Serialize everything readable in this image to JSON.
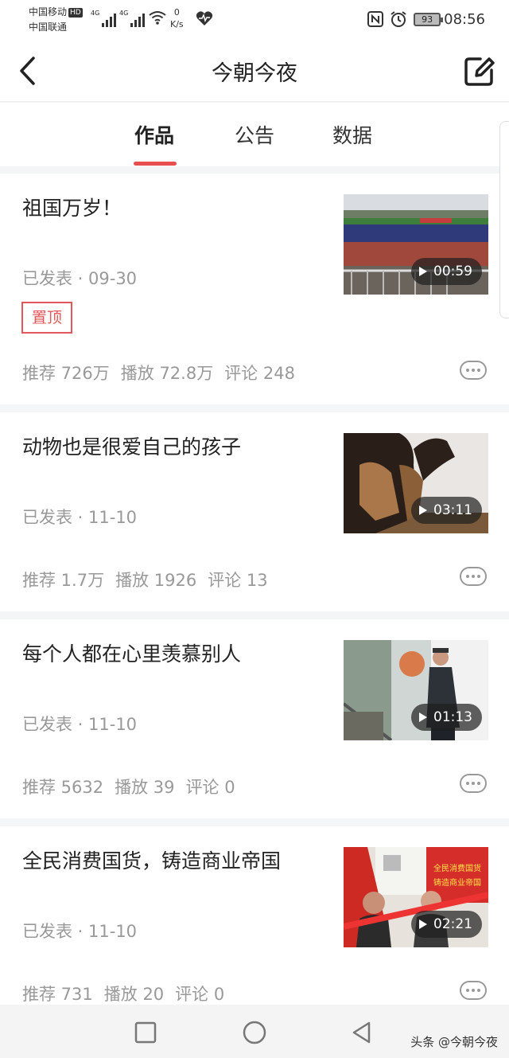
{
  "status_bar": {
    "carrier_1": "中国移动",
    "carrier_1_badge": "HD",
    "carrier_2": "中国联通",
    "signal_1_label": "4G",
    "signal_2_label": "4G",
    "net_speed_value": "0",
    "net_speed_unit": "K/s",
    "battery": "93",
    "time": "08:56"
  },
  "nav": {
    "title": "今朝今夜"
  },
  "tabs": [
    {
      "label": "作品",
      "active": true
    },
    {
      "label": "公告",
      "active": false
    },
    {
      "label": "数据",
      "active": false
    }
  ],
  "cards": [
    {
      "title": "祖国万岁！",
      "date": "已发表 · 09-30",
      "pin": "置顶",
      "recommend": "推荐 726万",
      "plays": "播放 72.8万",
      "comments": "评论 248",
      "duration": "00:59"
    },
    {
      "title": "动物也是很爱自己的孩子",
      "date": "已发表 · 11-10",
      "recommend": "推荐 1.7万",
      "plays": "播放 1926",
      "comments": "评论 13",
      "duration": "03:11"
    },
    {
      "title": "每个人都在心里羡慕别人",
      "date": "已发表 · 11-10",
      "recommend": "推荐 5632",
      "plays": "播放 39",
      "comments": "评论 0",
      "duration": "01:13"
    },
    {
      "title": "全民消费国货，铸造商业帝国",
      "date": "已发表 · 11-10",
      "recommend": "推荐 731",
      "plays": "播放 20",
      "comments": "评论 0",
      "duration": "02:21",
      "thumb_text_1": "全民消费国货",
      "thumb_text_2": "铸造商业帝国"
    }
  ],
  "watermark": "头条 @今朝今夜",
  "colors": {
    "accent": "#e94e4e",
    "pin": "#e4585b",
    "muted_text": "#999999",
    "background": "#f4f5f6"
  }
}
